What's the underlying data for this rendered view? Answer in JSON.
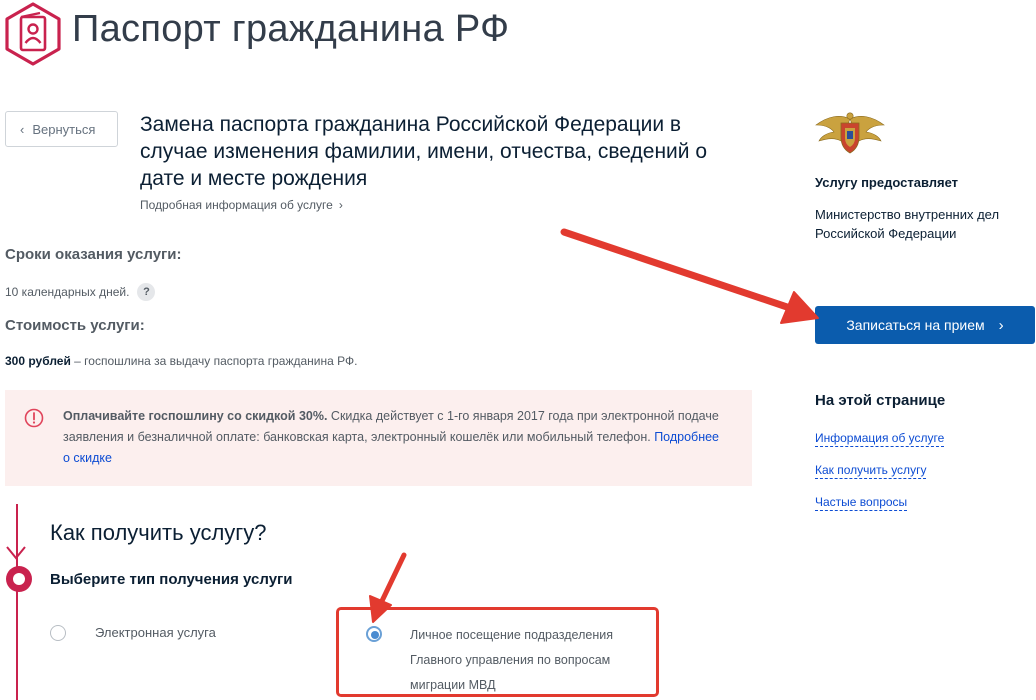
{
  "header": {
    "title": "Паспорт гражданина РФ"
  },
  "back_label": "Вернуться",
  "service": {
    "title": "Замена паспорта гражданина Российской Федерации в случае изменения фамилии, имени, отчества, сведений о дате и месте рождения",
    "details_link": "Подробная информация об услуге"
  },
  "terms": {
    "label": "Сроки оказания услуги:",
    "value": "10 календарных дней.",
    "help": "?"
  },
  "cost": {
    "label": "Стоимость услуги:",
    "amount": "300 рублей",
    "rest": " – госпошлина за выдачу паспорта гражданина РФ."
  },
  "discount": {
    "bold": "Оплачивайте госпошлину со скидкой 30%.",
    "text": " Скидка действует с 1-го января 2017 года при электронной подаче заявления и безналичной оплате: банковская карта, электронный кошелёк или мобильный телефон. ",
    "link": "Подробнее о скидке"
  },
  "how": {
    "title": "Как получить услугу?",
    "type_title": "Выберите тип получения услуги",
    "options": [
      {
        "label": "Электронная услуга",
        "selected": false
      },
      {
        "label": "Личное посещение подразделения Главного управления по вопросам миграции МВД",
        "selected": true
      }
    ]
  },
  "provider": {
    "label": "Услугу предоставляет",
    "name": "Министерство внутренних дел Российской Федерации"
  },
  "signup_label": "Записаться на прием",
  "on_page": {
    "label": "На этой странице",
    "links": [
      "Информация об услуге",
      "Как получить услугу",
      "Частые вопросы"
    ]
  },
  "colors": {
    "accent": "#c9224e",
    "primary": "#0b5cad",
    "link": "#0d4cd3",
    "annotation": "#e23a2f"
  }
}
